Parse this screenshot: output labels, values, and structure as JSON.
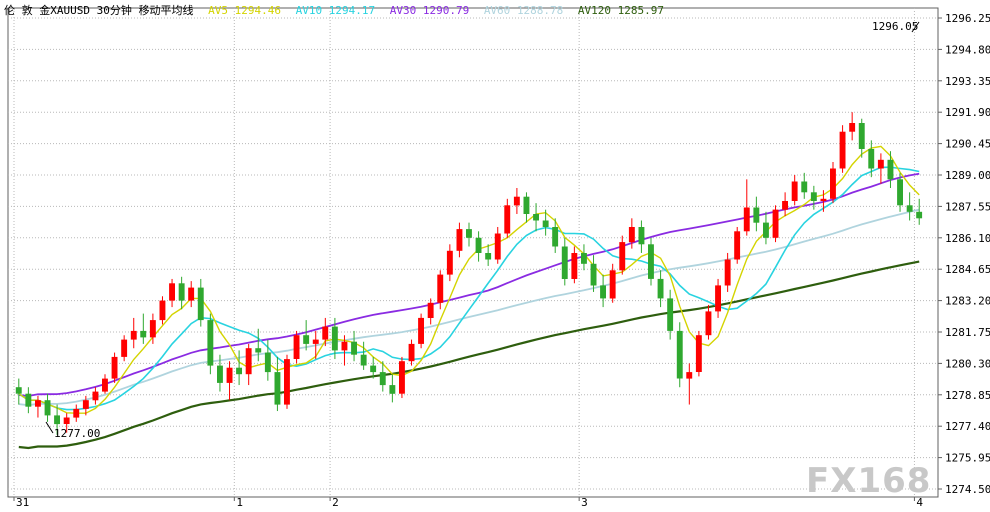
{
  "header": {
    "instrument_label": "伦 敦 金XAUUSD 30分钟 移动平均线",
    "ma": [
      {
        "label": "AV5",
        "value": "1294.46",
        "color": "#d4d400"
      },
      {
        "label": "AV10",
        "value": "1294.17",
        "color": "#29d3e0"
      },
      {
        "label": "AV30",
        "value": "1290.79",
        "color": "#8a2be2"
      },
      {
        "label": "AV60",
        "value": "1288.78",
        "color": "#b0d4de"
      },
      {
        "label": "AV120",
        "value": "1285.97",
        "color": "#2e5e0e"
      }
    ]
  },
  "watermark": "FX168",
  "annotations": {
    "high_label": "1296.05",
    "low_label": "1277.00"
  },
  "chart_data": {
    "type": "candlestick",
    "timeframe": "30分钟",
    "yaxis_ticks": [
      "1296.25",
      "1294.80",
      "1293.35",
      "1291.90",
      "1290.45",
      "1289.00",
      "1287.55",
      "1286.10",
      "1284.65",
      "1283.20",
      "1281.75",
      "1280.30",
      "1278.85",
      "1277.40",
      "1275.95",
      "1274.50"
    ],
    "ylim": [
      1274.5,
      1296.25
    ],
    "xaxis_labels": [
      {
        "label": "31",
        "index": 0
      },
      {
        "label": "1",
        "index": 23
      },
      {
        "label": "2",
        "index": 33
      },
      {
        "label": "3",
        "index": 59
      },
      {
        "label": "4",
        "index": 94
      }
    ],
    "up_color": "#ff0000",
    "down_color": "#2fa82f",
    "candles": [
      [
        1279.2,
        1279.6,
        1278.4,
        1278.9
      ],
      [
        1278.9,
        1279.2,
        1278.0,
        1278.3
      ],
      [
        1278.3,
        1278.8,
        1277.8,
        1278.6
      ],
      [
        1278.6,
        1278.9,
        1277.6,
        1277.9
      ],
      [
        1277.9,
        1278.4,
        1277.0,
        1277.5
      ],
      [
        1277.5,
        1278.0,
        1277.1,
        1277.8
      ],
      [
        1277.8,
        1278.4,
        1277.6,
        1278.2
      ],
      [
        1278.2,
        1278.8,
        1277.9,
        1278.6
      ],
      [
        1278.6,
        1279.2,
        1278.4,
        1279.0
      ],
      [
        1279.0,
        1279.8,
        1278.9,
        1279.6
      ],
      [
        1279.6,
        1280.8,
        1279.4,
        1280.6
      ],
      [
        1280.6,
        1281.6,
        1280.4,
        1281.4
      ],
      [
        1281.4,
        1282.4,
        1281.0,
        1281.8
      ],
      [
        1281.8,
        1282.6,
        1281.2,
        1281.5
      ],
      [
        1281.5,
        1282.6,
        1281.2,
        1282.3
      ],
      [
        1282.3,
        1283.4,
        1282.1,
        1283.2
      ],
      [
        1283.2,
        1284.2,
        1282.9,
        1284.0
      ],
      [
        1284.0,
        1284.3,
        1282.8,
        1283.2
      ],
      [
        1283.2,
        1284.1,
        1282.9,
        1283.8
      ],
      [
        1283.8,
        1284.2,
        1282.0,
        1282.3
      ],
      [
        1282.3,
        1282.6,
        1279.8,
        1280.2
      ],
      [
        1280.2,
        1280.7,
        1279.0,
        1279.4
      ],
      [
        1279.4,
        1280.4,
        1278.6,
        1280.1
      ],
      [
        1280.1,
        1280.9,
        1279.3,
        1279.8
      ],
      [
        1279.8,
        1281.2,
        1279.3,
        1281.0
      ],
      [
        1281.0,
        1281.9,
        1280.4,
        1280.8
      ],
      [
        1280.8,
        1281.4,
        1279.5,
        1279.9
      ],
      [
        1279.9,
        1280.6,
        1278.1,
        1278.4
      ],
      [
        1278.4,
        1280.7,
        1278.2,
        1280.5
      ],
      [
        1280.5,
        1281.8,
        1280.3,
        1281.6
      ],
      [
        1281.6,
        1282.3,
        1280.9,
        1281.2
      ],
      [
        1281.2,
        1281.8,
        1280.5,
        1281.4
      ],
      [
        1281.4,
        1282.4,
        1281.1,
        1282.0
      ],
      [
        1282.0,
        1282.4,
        1280.5,
        1280.9
      ],
      [
        1280.9,
        1281.6,
        1280.2,
        1281.3
      ],
      [
        1281.3,
        1281.8,
        1280.4,
        1280.7
      ],
      [
        1280.7,
        1281.3,
        1280.0,
        1280.2
      ],
      [
        1280.2,
        1280.6,
        1279.6,
        1279.9
      ],
      [
        1279.9,
        1280.4,
        1279.0,
        1279.3
      ],
      [
        1279.3,
        1279.8,
        1278.5,
        1278.9
      ],
      [
        1278.9,
        1280.6,
        1278.7,
        1280.4
      ],
      [
        1280.4,
        1281.4,
        1280.2,
        1281.2
      ],
      [
        1281.2,
        1282.6,
        1281.0,
        1282.4
      ],
      [
        1282.4,
        1283.3,
        1282.1,
        1283.1
      ],
      [
        1283.1,
        1284.6,
        1282.8,
        1284.4
      ],
      [
        1284.4,
        1285.8,
        1284.1,
        1285.5
      ],
      [
        1285.5,
        1286.8,
        1285.2,
        1286.5
      ],
      [
        1286.5,
        1286.8,
        1285.7,
        1286.1
      ],
      [
        1286.1,
        1286.4,
        1285.0,
        1285.4
      ],
      [
        1285.4,
        1285.8,
        1284.8,
        1285.1
      ],
      [
        1285.1,
        1286.6,
        1284.9,
        1286.3
      ],
      [
        1286.3,
        1287.9,
        1286.1,
        1287.6
      ],
      [
        1287.6,
        1288.4,
        1287.2,
        1288.0
      ],
      [
        1288.0,
        1288.2,
        1286.8,
        1287.2
      ],
      [
        1287.2,
        1287.7,
        1286.4,
        1286.9
      ],
      [
        1286.9,
        1287.4,
        1286.2,
        1286.6
      ],
      [
        1286.6,
        1287.0,
        1285.4,
        1285.7
      ],
      [
        1285.7,
        1286.1,
        1283.9,
        1284.2
      ],
      [
        1284.2,
        1285.7,
        1284.0,
        1285.4
      ],
      [
        1285.4,
        1285.8,
        1284.6,
        1284.9
      ],
      [
        1284.9,
        1285.3,
        1283.6,
        1283.9
      ],
      [
        1283.9,
        1284.4,
        1282.9,
        1283.3
      ],
      [
        1283.3,
        1284.9,
        1283.1,
        1284.6
      ],
      [
        1284.6,
        1286.2,
        1284.4,
        1285.9
      ],
      [
        1285.9,
        1287.0,
        1285.6,
        1286.6
      ],
      [
        1286.6,
        1286.9,
        1285.4,
        1285.8
      ],
      [
        1285.8,
        1286.1,
        1283.9,
        1284.2
      ],
      [
        1284.2,
        1284.6,
        1282.9,
        1283.3
      ],
      [
        1283.3,
        1283.7,
        1281.4,
        1281.8
      ],
      [
        1281.8,
        1282.2,
        1279.2,
        1279.6
      ],
      [
        1279.6,
        1280.3,
        1278.4,
        1279.9
      ],
      [
        1279.9,
        1281.8,
        1279.7,
        1281.6
      ],
      [
        1281.6,
        1283.0,
        1281.4,
        1282.7
      ],
      [
        1282.7,
        1284.2,
        1282.4,
        1283.9
      ],
      [
        1283.9,
        1285.4,
        1283.6,
        1285.1
      ],
      [
        1285.1,
        1286.6,
        1284.9,
        1286.4
      ],
      [
        1286.4,
        1288.8,
        1286.2,
        1287.5
      ],
      [
        1287.5,
        1288.0,
        1286.4,
        1286.8
      ],
      [
        1286.8,
        1287.3,
        1285.8,
        1286.1
      ],
      [
        1286.1,
        1287.6,
        1285.9,
        1287.4
      ],
      [
        1287.4,
        1288.2,
        1287.1,
        1287.8
      ],
      [
        1287.8,
        1289.0,
        1287.6,
        1288.7
      ],
      [
        1288.7,
        1289.1,
        1287.9,
        1288.2
      ],
      [
        1288.2,
        1288.5,
        1287.4,
        1287.8
      ],
      [
        1287.8,
        1288.3,
        1287.3,
        1287.9
      ],
      [
        1287.9,
        1289.6,
        1287.7,
        1289.3
      ],
      [
        1289.3,
        1291.3,
        1289.1,
        1291.0
      ],
      [
        1291.0,
        1291.9,
        1290.6,
        1291.4
      ],
      [
        1291.4,
        1291.6,
        1289.8,
        1290.2
      ],
      [
        1290.2,
        1290.6,
        1288.9,
        1289.3
      ],
      [
        1289.3,
        1290.0,
        1288.6,
        1289.7
      ],
      [
        1289.7,
        1290.1,
        1288.4,
        1288.8
      ],
      [
        1288.8,
        1289.1,
        1287.3,
        1287.6
      ],
      [
        1287.6,
        1288.2,
        1286.9,
        1287.3
      ],
      [
        1287.3,
        1287.9,
        1286.7,
        1287.0
      ]
    ]
  }
}
